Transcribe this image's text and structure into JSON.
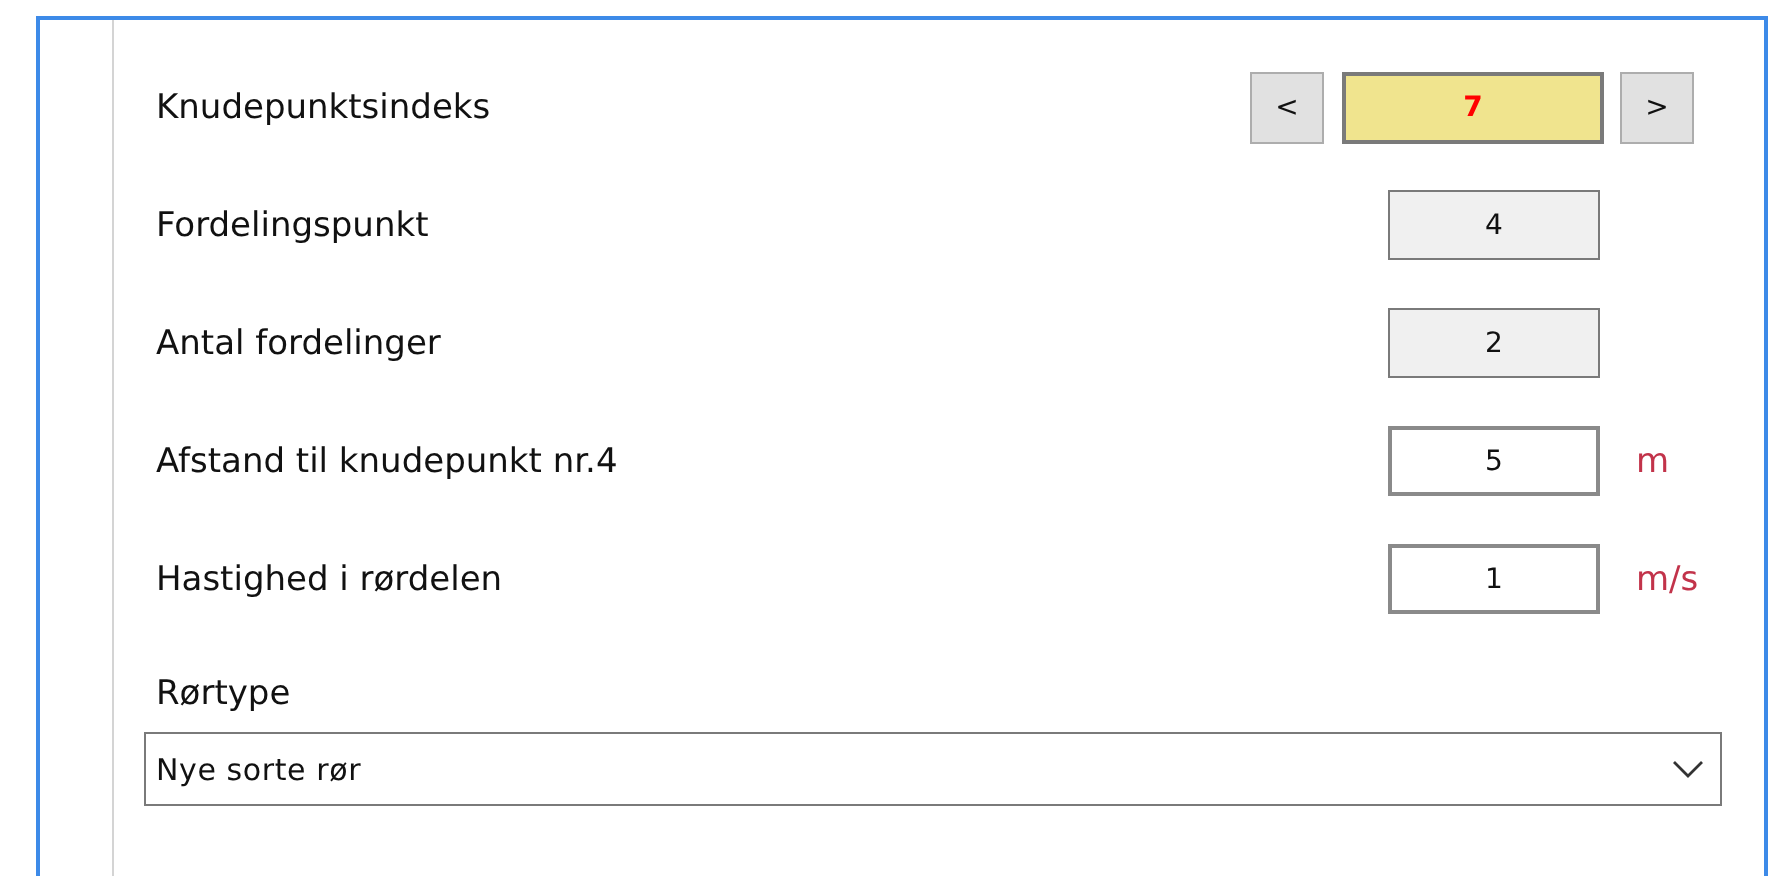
{
  "rows": [
    {
      "kind": "stepper",
      "label": "Knudepunktsindeks",
      "prev": "<",
      "value": "7",
      "next": ">"
    },
    {
      "kind": "readonly",
      "label": "Fordelingspunkt",
      "value": "4"
    },
    {
      "kind": "readonly",
      "label": "Antal fordelinger",
      "value": "2"
    },
    {
      "kind": "input",
      "label": "Afstand til knudepunkt nr.4",
      "value": "5",
      "unit": "m"
    },
    {
      "kind": "input",
      "label": "Hastighed i rørdelen",
      "value": "1",
      "unit": "m/s"
    }
  ],
  "pipe_type": {
    "label": "Rørtype",
    "value": "Nye sorte rør"
  }
}
